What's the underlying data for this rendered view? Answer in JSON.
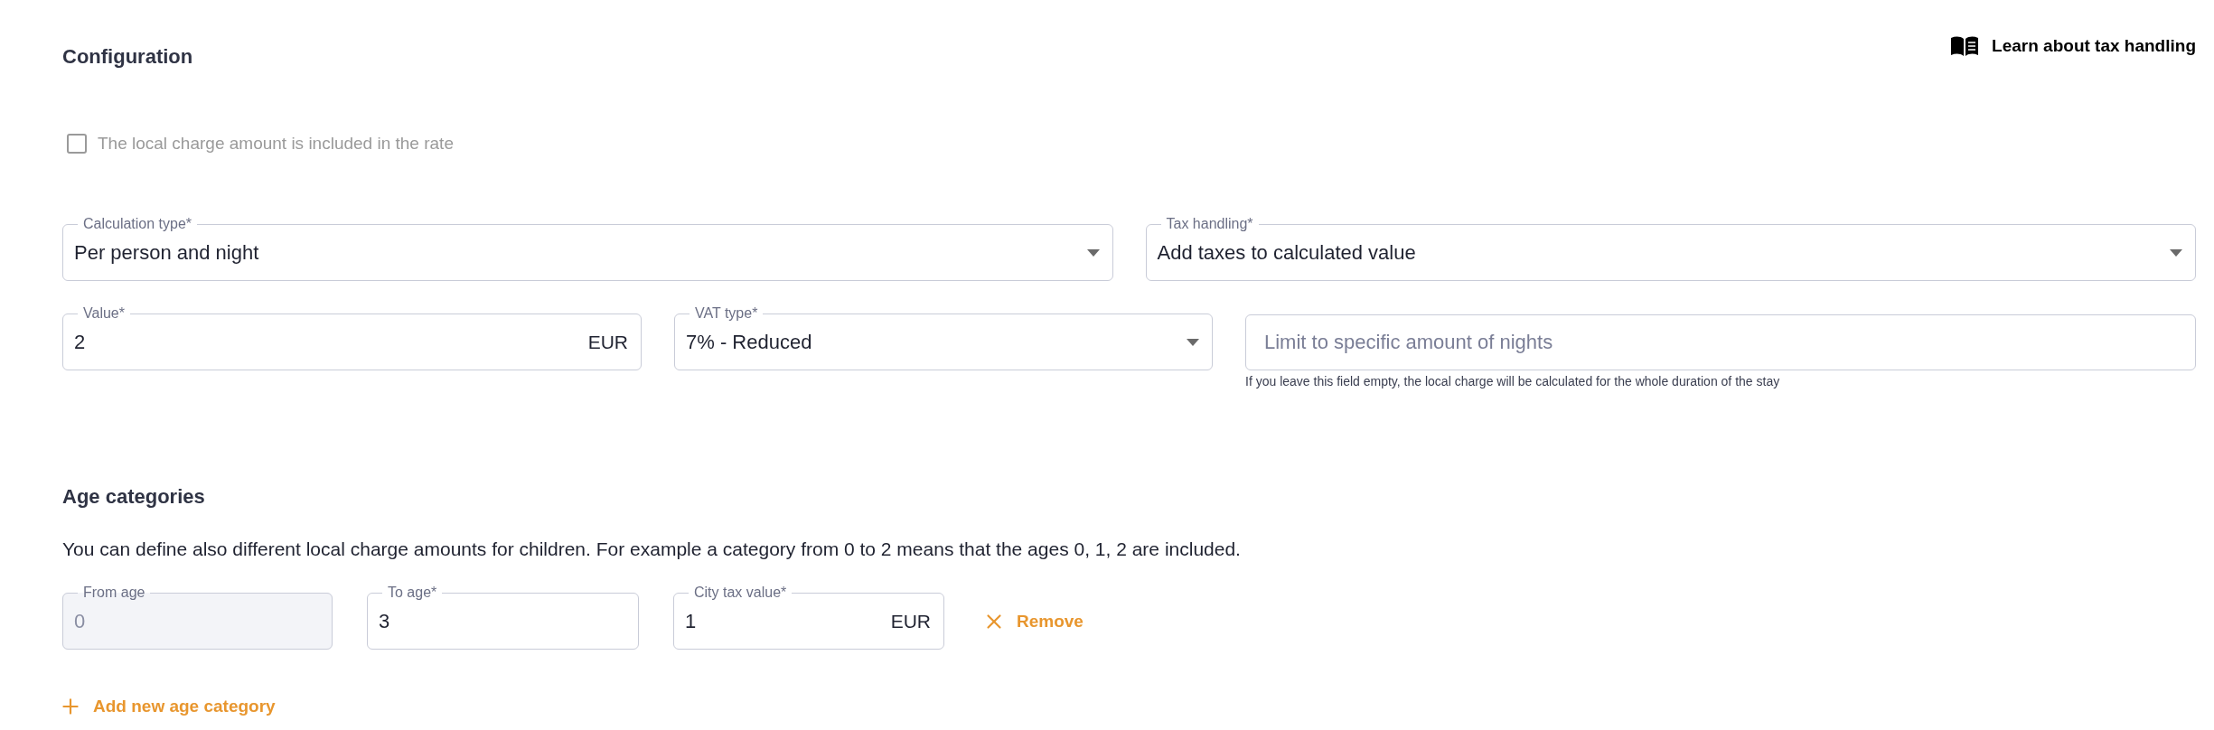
{
  "heading": "Configuration",
  "help_link": {
    "label": "Learn about tax handling"
  },
  "checkbox": {
    "label": "The local charge amount is included in the rate",
    "checked": false,
    "disabled": true
  },
  "field_rows": [
    [
      {
        "kind": "select",
        "label": "Calculation type*",
        "value": "Per person and night",
        "disabled": false
      },
      {
        "kind": "select",
        "label": "Tax handling*",
        "value": "Add taxes to calculated value",
        "disabled": false
      }
    ],
    [
      {
        "kind": "text",
        "label": "Value*",
        "value": "2",
        "suffix": "EUR",
        "disabled": false
      },
      {
        "kind": "select",
        "label": "VAT type*",
        "value": "7% - Reduced",
        "disabled": false
      },
      {
        "kind": "text",
        "placeholder": "Limit to specific amount of nights",
        "hint": "If you leave this field empty, the local charge will be calculated for the whole duration of the stay",
        "disabled": false
      }
    ]
  ],
  "age_categories": {
    "heading": "Age categories",
    "description": "You can define also different local charge amounts for children. For example a category from 0 to 2 means that the ages 0, 1, 2 are included.",
    "rows": [
      {
        "fields": [
          {
            "label": "From age",
            "value": "0",
            "disabled": true
          },
          {
            "label": "To age*",
            "value": "3",
            "disabled": false
          },
          {
            "label": "City tax value*",
            "value": "1",
            "suffix": "EUR",
            "disabled": false
          }
        ],
        "remove_label": "Remove"
      }
    ],
    "add_label": "Add new age category"
  }
}
